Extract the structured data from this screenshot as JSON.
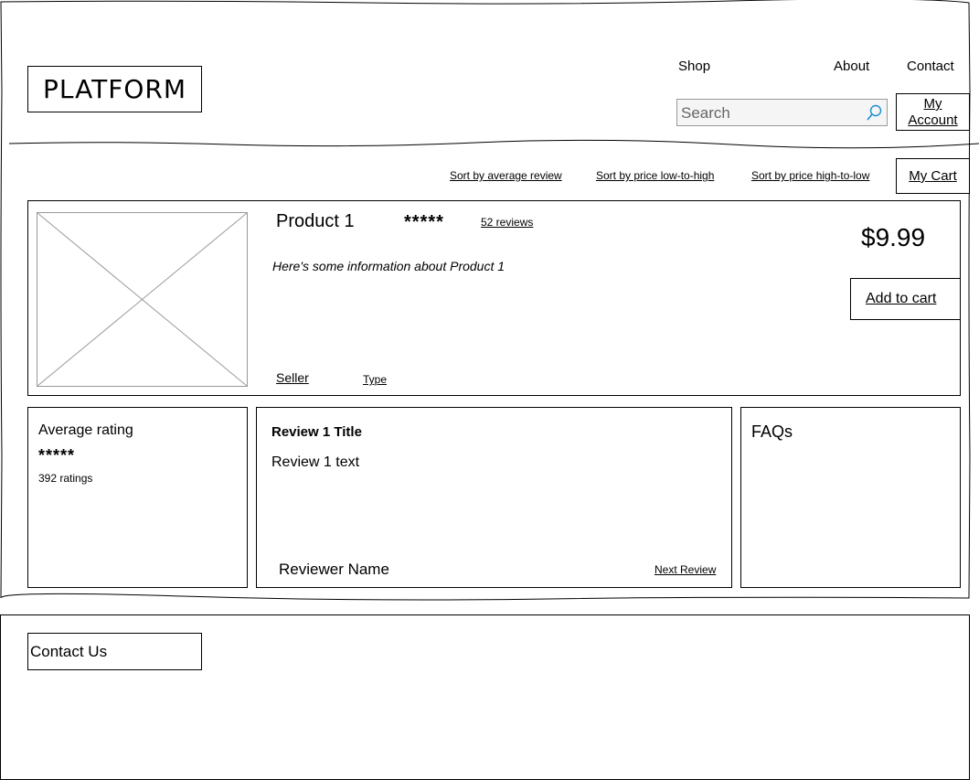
{
  "header": {
    "logo": "PLATFORM",
    "nav": {
      "shop": "Shop",
      "about": "About",
      "contact": "Contact"
    },
    "search": {
      "placeholder": "Search",
      "icon": "search-icon"
    },
    "account_line1": "My",
    "account_line2": "Account"
  },
  "sort": {
    "by_review": "Sort by average review",
    "price_low_high": "Sort by price low-to-high",
    "price_high_low": "Sort by price high-to-low"
  },
  "cart_label": "My Cart",
  "product": {
    "name": "Product 1",
    "stars": "*****",
    "reviews_link": "52 reviews",
    "info": "Here's some information about Product 1",
    "price": "$9.99",
    "add_to_cart": "Add to cart",
    "seller": "Seller",
    "type": "Type"
  },
  "rating": {
    "title": "Average rating",
    "stars": "*****",
    "count": "392 ratings"
  },
  "review": {
    "title": "Review 1 Title",
    "text": "Review 1 text",
    "reviewer": "Reviewer Name",
    "next": "Next Review"
  },
  "faq": {
    "title": "FAQs"
  },
  "footer": {
    "contact_us": "Contact Us"
  },
  "colors": {
    "search_icon": "#1a8fd0",
    "placeholder_border": "#999999"
  }
}
